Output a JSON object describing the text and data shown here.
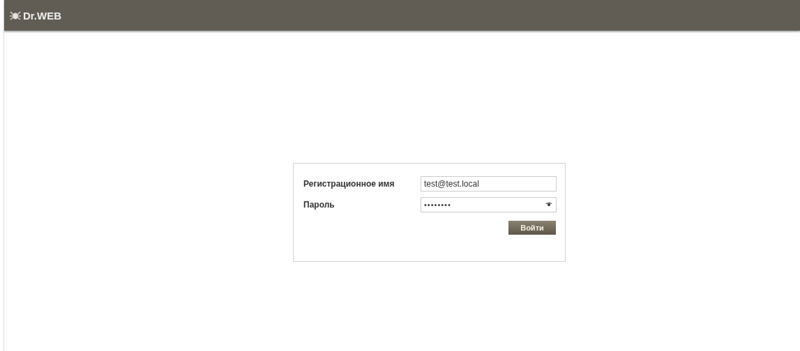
{
  "header": {
    "logo": "Dr.WEB"
  },
  "login_form": {
    "fields": [
      {
        "label": "Регистрационное имя",
        "value": "test@test.local",
        "kind": "text"
      },
      {
        "label": "Пароль",
        "value": "••••••••",
        "kind": "password"
      }
    ],
    "submit_button": "Войти"
  }
}
